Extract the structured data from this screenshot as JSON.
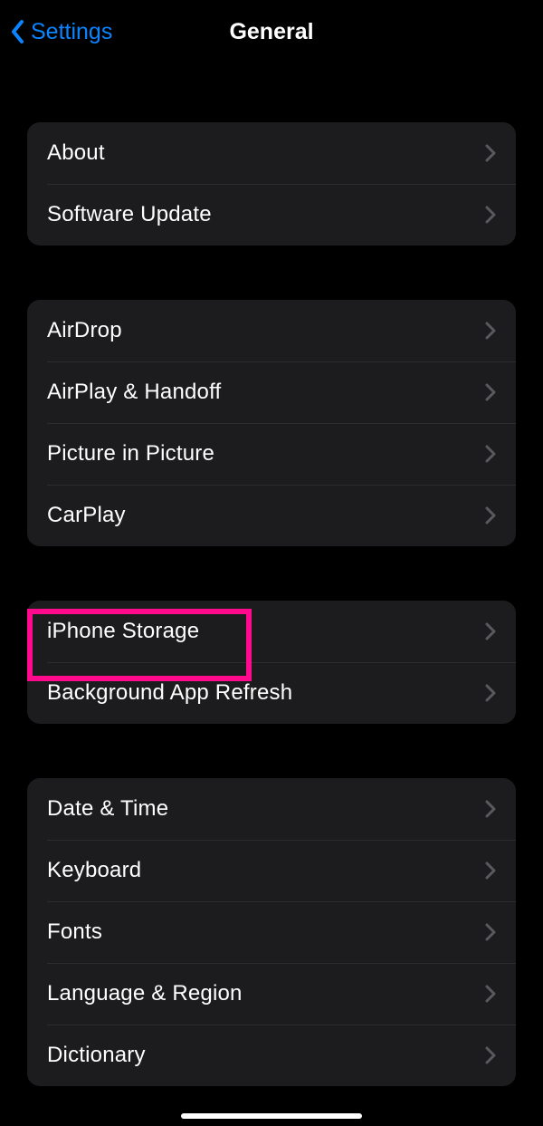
{
  "nav": {
    "back_label": "Settings",
    "title": "General"
  },
  "groups": [
    {
      "items": [
        {
          "label": "About"
        },
        {
          "label": "Software Update"
        }
      ]
    },
    {
      "items": [
        {
          "label": "AirDrop"
        },
        {
          "label": "AirPlay & Handoff"
        },
        {
          "label": "Picture in Picture"
        },
        {
          "label": "CarPlay"
        }
      ]
    },
    {
      "items": [
        {
          "label": "iPhone Storage"
        },
        {
          "label": "Background App Refresh"
        }
      ]
    },
    {
      "items": [
        {
          "label": "Date & Time"
        },
        {
          "label": "Keyboard"
        },
        {
          "label": "Fonts"
        },
        {
          "label": "Language & Region"
        },
        {
          "label": "Dictionary"
        }
      ]
    }
  ],
  "annotation": {
    "highlighted_item": "iPhone Storage"
  }
}
